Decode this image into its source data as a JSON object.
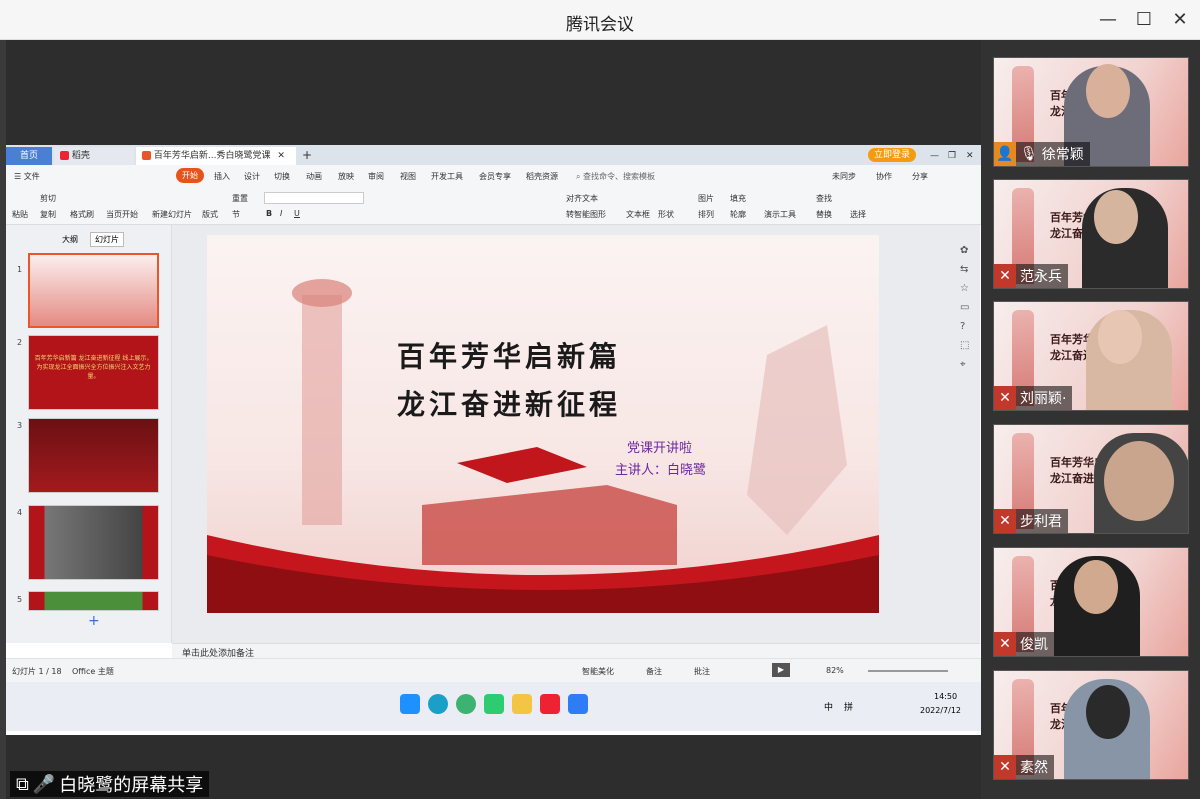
{
  "window": {
    "title": "腾讯会议"
  },
  "share_label": "白晓鹭的屏幕共享",
  "participants": [
    {
      "name": "徐常颖",
      "mic": "on"
    },
    {
      "name": "范永兵",
      "mic": "muted"
    },
    {
      "name": "刘丽颖·",
      "mic": "muted"
    },
    {
      "name": "步利君",
      "mic": "muted"
    },
    {
      "name": "俊凯",
      "mic": "muted"
    },
    {
      "name": "素然",
      "mic": "muted"
    }
  ],
  "tile_slide": {
    "line1": "百年芳华启",
    "line2": "龙江奋进"
  },
  "wps": {
    "tabs": [
      "首页",
      "稻壳",
      "百年芳华启新...秀白晓鹭党课"
    ],
    "login": "立即登录",
    "menu": [
      "文件",
      "开始",
      "插入",
      "设计",
      "切换",
      "动画",
      "放映",
      "审阅",
      "视图",
      "开发工具",
      "会员专享",
      "稻壳资源"
    ],
    "search": "查找命令、搜索模板",
    "right_actions": [
      "未同步",
      "协作",
      "分享"
    ],
    "toolbar": {
      "paste": "粘贴",
      "cut": "剪切",
      "copy": "复制",
      "format_painter": "格式刷",
      "play_from_current": "当页开始",
      "new_slide": "新建幻灯片",
      "layout": "版式",
      "section": "节",
      "reset": "重置",
      "align_text": "对齐文本",
      "convert_smartart": "转智能图形",
      "textbox": "文本框",
      "shapes": "形状",
      "arrange": "排列",
      "picture": "图片",
      "fill": "填充",
      "outline": "轮廓",
      "presentation_tools": "演示工具",
      "find": "查找",
      "replace": "替换",
      "select": "选择"
    },
    "panel_tabs": [
      "大纲",
      "幻灯片"
    ],
    "thumb_numbers": [
      "1",
      "2",
      "3",
      "4",
      "5"
    ],
    "thumb2_text": "百年芳华启新篇 龙江奋进新征程 线上展示，为实现龙江全面振兴全方位振兴注入文艺力量。",
    "slide": {
      "title1": "百年芳华启新篇",
      "title2": "龙江奋进新征程",
      "subtitle1": "党课开讲啦",
      "subtitle2": "主讲人：白晓鹭"
    },
    "notes_placeholder": "单击此处添加备注",
    "status": {
      "slide_count": "幻灯片 1 / 18",
      "theme": "Office 主题",
      "smart_beautify": "智能美化",
      "notes": "备注",
      "comments": "批注",
      "zoom": "82%"
    },
    "taskbar": {
      "time": "14:50",
      "date": "2022/7/12",
      "ime1": "中",
      "ime2": "拼"
    }
  }
}
